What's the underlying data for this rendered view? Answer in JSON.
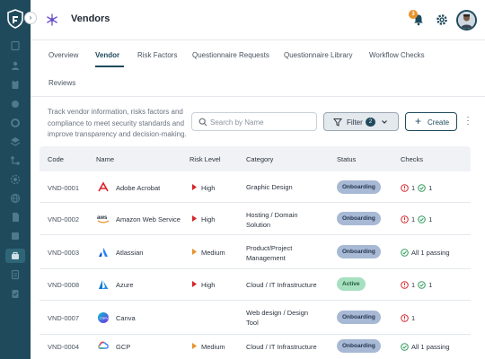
{
  "header": {
    "title": "Vendors",
    "notification_count": "3"
  },
  "tabs": [
    {
      "label": "Overview"
    },
    {
      "label": "Vendor"
    },
    {
      "label": "Risk Factors"
    },
    {
      "label": "Questionnaire Requests"
    },
    {
      "label": "Questionnaire Library"
    },
    {
      "label": "Workflow Checks"
    },
    {
      "label": "Reviews"
    }
  ],
  "toolbar": {
    "description": "Track vendor information, risks factors and compliance to meet security standards and improve transparency and decision-making.",
    "search_placeholder": "Search by Name",
    "filter_label": "Filter",
    "filter_count": "2",
    "create_label": "Create"
  },
  "table": {
    "columns": [
      "Code",
      "Name",
      "Risk Level",
      "Category",
      "Status",
      "Checks"
    ],
    "rows": [
      {
        "code": "VND-0001",
        "name": "Adobe Acrobat",
        "logo": "adobe-acrobat-logo",
        "risk": "High",
        "category": "Graphic Design",
        "status": "Onboarding",
        "checks_fail": "1",
        "checks_pass": "1",
        "checks_text": ""
      },
      {
        "code": "VND-0002",
        "name": "Amazon Web Service",
        "logo": "aws-logo",
        "risk": "High",
        "category": "Hosting / Domain Solution",
        "status": "Onboarding",
        "checks_fail": "1",
        "checks_pass": "1",
        "checks_text": ""
      },
      {
        "code": "VND-0003",
        "name": "Atlassian",
        "logo": "atlassian-logo",
        "risk": "Medium",
        "category": "Product/Project Management",
        "status": "Onboarding",
        "checks_fail": "",
        "checks_pass": "",
        "checks_text": "All 1 passing"
      },
      {
        "code": "VND-0008",
        "name": "Azure",
        "logo": "azure-logo",
        "risk": "High",
        "category": "Cloud / IT Infrastructure",
        "status": "Active",
        "checks_fail": "1",
        "checks_pass": "1",
        "checks_text": ""
      },
      {
        "code": "VND-0007",
        "name": "Canva",
        "logo": "canva-logo",
        "risk": "",
        "category": "Web design / Design Tool",
        "status": "Onboarding",
        "checks_fail": "1",
        "checks_pass": "",
        "checks_text": ""
      },
      {
        "code": "VND-0004",
        "name": "GCP",
        "logo": "gcp-logo",
        "risk": "Medium",
        "category": "Cloud / IT Infrastructure",
        "status": "Onboarding",
        "checks_fail": "",
        "checks_pass": "",
        "checks_text": "All 1 passing"
      }
    ]
  },
  "colors": {
    "sidebar": "#1f4a5c",
    "accent": "#1f4a5c",
    "risk_high": "#d8232a",
    "risk_medium": "#e8922a",
    "status_onboarding": "#a7b9d4",
    "status_active": "#a6e0bf",
    "check_fail": "#d8232a",
    "check_pass": "#2e9a5b"
  }
}
